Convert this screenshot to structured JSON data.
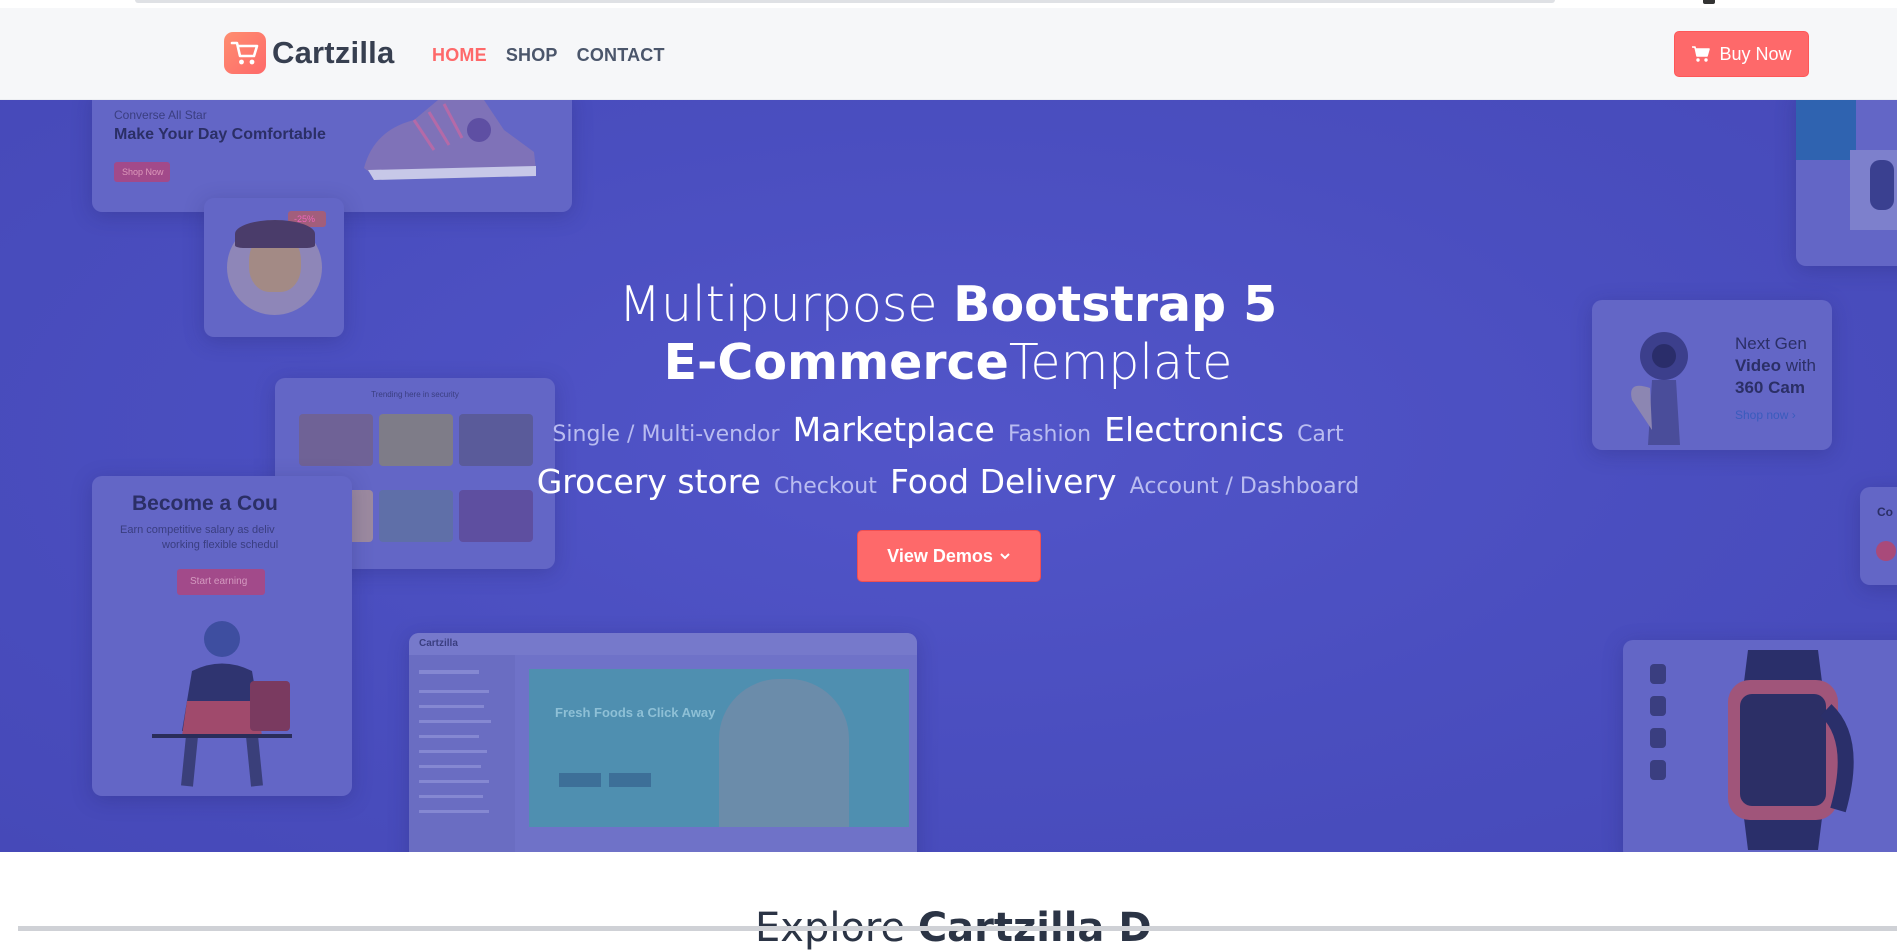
{
  "brand": {
    "name": "Cartzilla",
    "logo_icon": "cart-icon"
  },
  "nav": {
    "items": [
      {
        "label": "HOME",
        "active": true
      },
      {
        "label": "SHOP",
        "active": false
      },
      {
        "label": "CONTACT",
        "active": false
      }
    ]
  },
  "buy_button": {
    "label": "Buy Now",
    "icon": "cart-icon"
  },
  "hero": {
    "title_part1": "Multipurpose ",
    "title_bold1": "Bootstrap 5",
    "title_bold2": "E-Commerce",
    "title_part2": "Template",
    "tags_line1": [
      {
        "text": "Single / Multi-vendor",
        "size": "small"
      },
      {
        "text": "Marketplace",
        "size": "large"
      },
      {
        "text": "Fashion",
        "size": "small"
      },
      {
        "text": "Electronics",
        "size": "large"
      },
      {
        "text": "Cart",
        "size": "small"
      }
    ],
    "tags_line2": [
      {
        "text": "Grocery store",
        "size": "large"
      },
      {
        "text": "Checkout",
        "size": "small"
      },
      {
        "text": "Food Delivery",
        "size": "large"
      },
      {
        "text": "Account / Dashboard",
        "size": "small"
      }
    ],
    "cta_label": "View Demos",
    "cta_icon": "chevron-down-icon"
  },
  "bg_cards": {
    "converse_kicker": "Converse All Star",
    "converse_title": "Make Your Day Comfortable",
    "converse_btn": "Shop Now",
    "badge_text": "-25%",
    "courier_title": "Become a Cou",
    "courier_text1": "Earn competitive salary as deliv",
    "courier_text2": "working flexible schedul",
    "courier_btn": "Start earning",
    "trending_title": "Trending here in security",
    "cam_line1": "Next Gen",
    "cam_line2a": "Video",
    "cam_line2b": " with",
    "cam_line3": "360 Cam",
    "cam_link": "Shop now",
    "grocery_logo": "Cartzilla",
    "grocery_title": "Fresh Foods a Click Away",
    "right_cut_text": "Co"
  },
  "colors": {
    "accent": "#fe696a",
    "hero_bg": "#4a4ebf",
    "text_dark": "#373f50"
  },
  "next_section": {
    "title_part1": "Explore ",
    "title_bold": "Cartzilla D"
  }
}
